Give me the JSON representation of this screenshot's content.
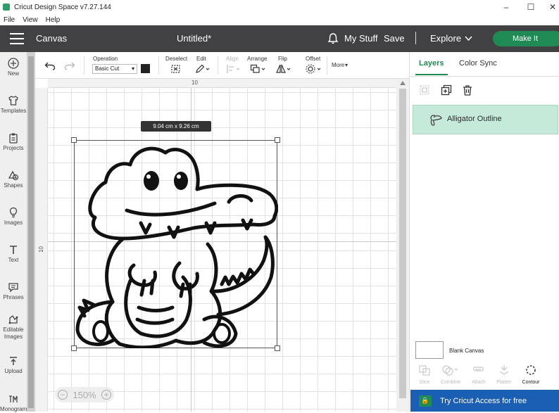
{
  "window": {
    "title": "Cricut Design Space   v7.27.144",
    "controls": [
      "–",
      "☐",
      "✕"
    ]
  },
  "menu": [
    "File",
    "View",
    "Help"
  ],
  "header": {
    "section": "Canvas",
    "doc_title": "Untitled*",
    "my_stuff": "My Stuff",
    "save": "Save",
    "explore": "Explore",
    "make_it": "Make It"
  },
  "left_tools": [
    {
      "label": "New",
      "icon": "plus-circle-icon"
    },
    {
      "label": "Templates",
      "icon": "shirt-icon"
    },
    {
      "label": "Projects",
      "icon": "clipboard-icon"
    },
    {
      "label": "Shapes",
      "icon": "shapes-icon"
    },
    {
      "label": "Images",
      "icon": "bulb-icon"
    },
    {
      "label": "Text",
      "icon": "text-t-icon"
    },
    {
      "label": "Phrases",
      "icon": "speech-bubble-icon"
    },
    {
      "label": "Editable Images",
      "icon": "editable-images-icon"
    },
    {
      "label": "Upload",
      "icon": "upload-icon"
    },
    {
      "label": "Monogram",
      "icon": "monogram-icon"
    }
  ],
  "toolbar": {
    "operation_label": "Operation",
    "operation_value": "Basic Cut",
    "deselect": "Deselect",
    "edit": "Edit",
    "align": "Align",
    "arrange": "Arrange",
    "flip": "Flip",
    "offset": "Offset",
    "more": "More"
  },
  "canvas": {
    "ruler_top_label": "10",
    "ruler_left_label": "10",
    "dimensions": "9.04  cm x 9.26  cm",
    "zoom": "150%"
  },
  "right_panel": {
    "tabs": [
      "Layers",
      "Color Sync"
    ],
    "active_tab": "Layers",
    "layer_name": "Alligator Outline",
    "blank_canvas": "Blank Canvas",
    "tools": [
      {
        "label": "Slice",
        "enabled": false
      },
      {
        "label": "Combine",
        "enabled": false
      },
      {
        "label": "Attach",
        "enabled": false
      },
      {
        "label": "Flatten",
        "enabled": false
      },
      {
        "label": "Contour",
        "enabled": true
      }
    ],
    "access_cta": "Try Cricut Access for free"
  },
  "colors": {
    "brand_green": "#1f8a54",
    "header_dark": "#414042",
    "access_blue": "#1a5fb4",
    "layer_highlight": "#c6ead9"
  }
}
